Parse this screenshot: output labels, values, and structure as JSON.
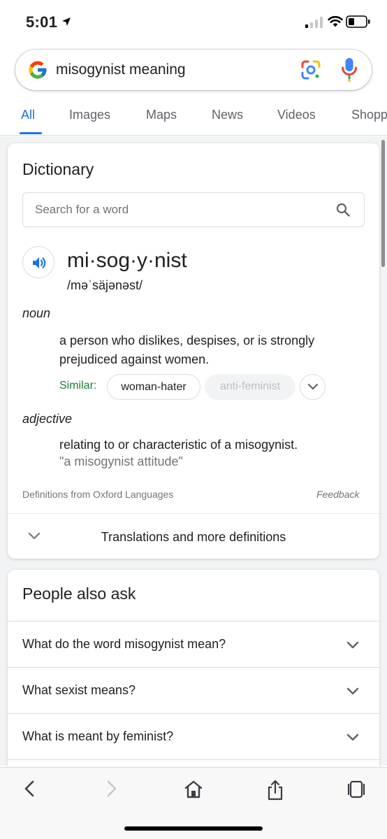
{
  "status_bar": {
    "time": "5:01"
  },
  "search": {
    "query": "misogynist meaning",
    "icons": [
      "google-logo",
      "lens-icon",
      "mic-icon"
    ]
  },
  "tabs": [
    {
      "label": "All",
      "active": true
    },
    {
      "label": "Images"
    },
    {
      "label": "Maps"
    },
    {
      "label": "News"
    },
    {
      "label": "Videos"
    },
    {
      "label": "Shopping"
    }
  ],
  "dictionary": {
    "title": "Dictionary",
    "search_placeholder": "Search for a word",
    "headword": "mi·sog·y·nist",
    "phonetic": "/məˈsäjənəst/",
    "senses": [
      {
        "part_of_speech": "noun",
        "definition": "a person who dislikes, despises, or is strongly prejudiced against women.",
        "similar_label": "Similar:",
        "similar": [
          "woman-hater",
          "anti-feminist"
        ]
      },
      {
        "part_of_speech": "adjective",
        "definition": "relating to or characteristic of a misogynist.",
        "example": "\"a misogynist attitude\""
      }
    ],
    "source": "Definitions from Oxford Languages",
    "feedback": "Feedback",
    "more_label": "Translations and more definitions"
  },
  "people_also_ask": {
    "title": "People also ask",
    "questions": [
      "What do the word misogynist mean?",
      "What sexist means?",
      "What is meant by feminist?"
    ]
  },
  "bottom_bar": {
    "icons": [
      "back-icon",
      "forward-icon",
      "home-icon",
      "share-icon",
      "tabs-icon"
    ]
  },
  "colors": {
    "accent": "#1a73e8",
    "similar_green": "#188038",
    "muted": "#70757a"
  }
}
